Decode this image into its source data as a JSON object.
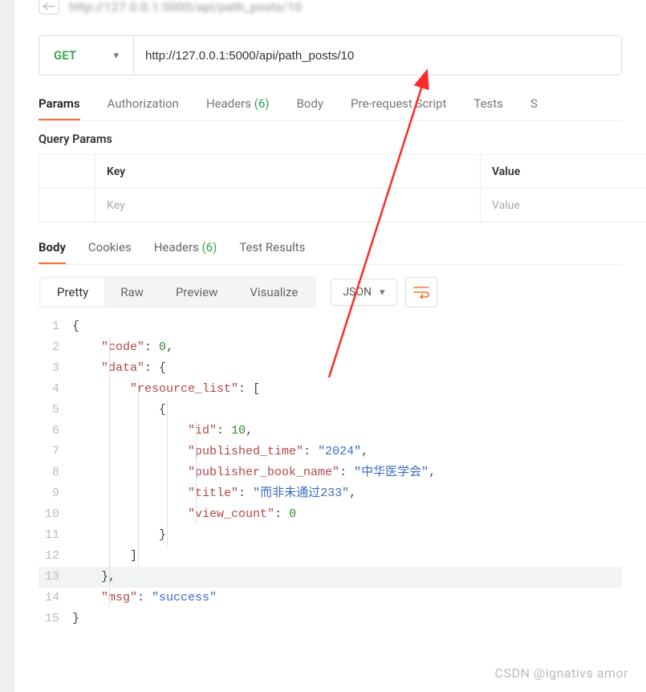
{
  "history": {
    "url": "http://127.0.0.1:5000/api/path_posts/10"
  },
  "request": {
    "method": "GET",
    "url": "http://127.0.0.1:5000/api/path_posts/10"
  },
  "req_tabs": {
    "params": "Params",
    "auth": "Authorization",
    "headers": "Headers",
    "headers_count": "(6)",
    "body": "Body",
    "prerequest": "Pre-request Script",
    "tests": "Tests",
    "settings_initial": "S"
  },
  "query_params": {
    "title": "Query Params",
    "header_key": "Key",
    "header_value": "Value",
    "placeholder_key": "Key",
    "placeholder_value": "Value"
  },
  "res_tabs": {
    "body": "Body",
    "cookies": "Cookies",
    "headers": "Headers",
    "headers_count": "(6)",
    "test_results": "Test Results"
  },
  "view": {
    "pretty": "Pretty",
    "raw": "Raw",
    "preview": "Preview",
    "visualize": "Visualize",
    "format": "JSON"
  },
  "code": {
    "l1": "{",
    "l2_key": "\"code\"",
    "l2_val": "0",
    "l3_key": "\"data\"",
    "l4_key": "\"resource_list\"",
    "l6_key": "\"id\"",
    "l6_val": "10",
    "l7_key": "\"published_time\"",
    "l7_val": "\"2024\"",
    "l8_key": "\"publisher_book_name\"",
    "l8_val": "\"中华医学会\"",
    "l9_key": "\"title\"",
    "l9_val": "\"而非未通过233\"",
    "l10_key": "\"view_count\"",
    "l10_val": "0",
    "l14_key": "\"msg\"",
    "l14_val": "\"success\""
  },
  "watermark": "CSDN @ignativs  amor"
}
